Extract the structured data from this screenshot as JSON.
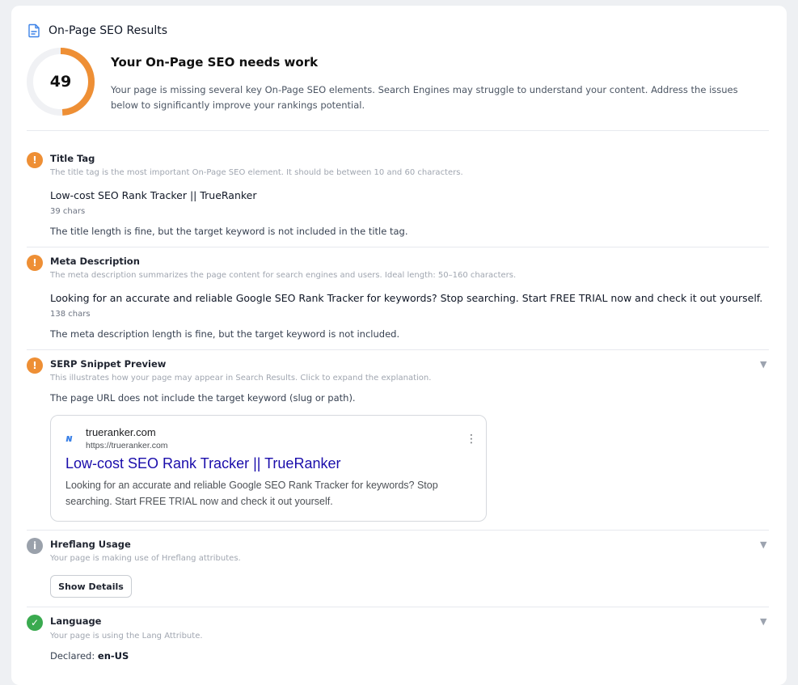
{
  "panel": {
    "title": "On-Page SEO Results",
    "score": "49",
    "score_value": 49,
    "score_color": "#ee8f35",
    "heading": "Your On-Page SEO needs work",
    "description": "Your page is missing several key On-Page SEO elements. Search Engines may struggle to understand your content. Address the issues below to significantly improve your rankings potential."
  },
  "sections": {
    "title_tag": {
      "title": "Title Tag",
      "description": "The title tag is the most important On-Page SEO element. It should be between 10 and 60 characters.",
      "value": "Low-cost SEO Rank Tracker || TrueRanker",
      "count": "39 chars",
      "note": "The title length is fine, but the target keyword is not included in the title tag.",
      "status_icon": "!"
    },
    "meta_description": {
      "title": "Meta Description",
      "description": "The meta description summarizes the page content for search engines and users. Ideal length: 50–160 characters.",
      "value": "Looking for an accurate and reliable Google SEO Rank Tracker for keywords? Stop searching. Start FREE TRIAL now and check it out yourself.",
      "count": "138 chars",
      "note": "The meta description length is fine, but the target keyword is not included.",
      "status_icon": "!"
    },
    "serp_snippet": {
      "title": "SERP Snippet Preview",
      "description": "This illustrates how your page may appear in Search Results. Click to expand the explanation.",
      "note": "The page URL does not include the target keyword (slug or path).",
      "status_icon": "!",
      "preview": {
        "site_name": "trueranker.com",
        "url": "https://trueranker.com",
        "title": "Low-cost SEO Rank Tracker || TrueRanker",
        "description": "Looking for an accurate and reliable Google SEO Rank Tracker for keywords? Stop searching. Start FREE TRIAL now and check it out yourself.",
        "logo": "ɴ",
        "menu_icon": "⋮"
      }
    },
    "hreflang": {
      "title": "Hreflang Usage",
      "description": "Your page is making use of Hreflang attributes.",
      "button": "Show Details",
      "status_icon": "i"
    },
    "language": {
      "title": "Language",
      "description": "Your page is using the Lang Attribute.",
      "declared_label": "Declared:",
      "declared_value": "en-US",
      "status_icon": "✓"
    }
  },
  "icons": {
    "expand": "▼"
  }
}
